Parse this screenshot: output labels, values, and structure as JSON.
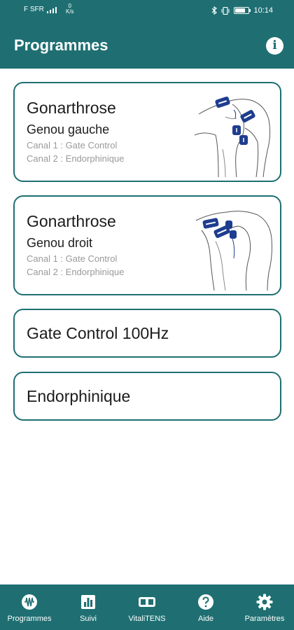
{
  "status_bar": {
    "carrier": "F SFR",
    "net_speed_value": "0",
    "net_speed_unit": "K/s",
    "time": "10:14"
  },
  "header": {
    "title": "Programmes",
    "info_icon": "info-icon",
    "info_glyph": "i"
  },
  "programs": [
    {
      "title": "Gonarthrose",
      "subtitle": "Genou gauche",
      "channel1": "Canal 1 : Gate Control",
      "channel2": "Canal 2 : Endorphinique",
      "image": "knee-left-electrodes"
    },
    {
      "title": "Gonarthrose",
      "subtitle": "Genou droit",
      "channel1": "Canal 1 : Gate Control",
      "channel2": "Canal 2 : Endorphinique",
      "image": "knee-right-electrodes"
    },
    {
      "title": "Gate Control 100Hz"
    },
    {
      "title": "Endorphinique"
    }
  ],
  "bottom_nav": {
    "items": [
      {
        "label": "Programmes",
        "icon": "waveform-icon",
        "active": true
      },
      {
        "label": "Suivi",
        "icon": "bar-chart-icon"
      },
      {
        "label": "VitaliTENS",
        "icon": "device-icon"
      },
      {
        "label": "Aide",
        "icon": "help-icon"
      },
      {
        "label": "Paramètres",
        "icon": "gear-icon"
      }
    ]
  },
  "colors": {
    "primary": "#1f6f72",
    "electrode": "#1e3d8f",
    "text": "#1c1c1c",
    "muted_text": "#9a9a9a"
  }
}
